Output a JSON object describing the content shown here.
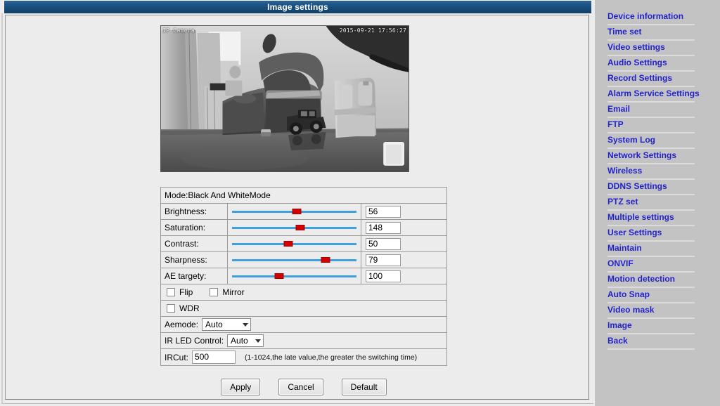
{
  "window": {
    "title": "Image settings"
  },
  "video": {
    "osd_label": "IP Camera",
    "osd_timestamp": "2015-09-21 17:56:27"
  },
  "settings": {
    "mode_text": "Mode:Black And WhiteMode",
    "sliders": [
      {
        "label": "Brightness:",
        "value": "56",
        "percent": 52
      },
      {
        "label": "Saturation:",
        "value": "148",
        "percent": 55
      },
      {
        "label": "Contrast:",
        "value": "50",
        "percent": 45
      },
      {
        "label": "Sharpness:",
        "value": "79",
        "percent": 75
      },
      {
        "label": "AE targety:",
        "value": "100",
        "percent": 38
      }
    ],
    "flip_label": "Flip",
    "mirror_label": "Mirror",
    "wdr_label": "WDR",
    "flip_checked": false,
    "mirror_checked": false,
    "wdr_checked": false,
    "aemode_label": "Aemode:",
    "aemode_value": "Auto",
    "aemode_options": [
      "Auto"
    ],
    "irled_label": "IR LED Control:",
    "irled_value": "Auto",
    "irled_options": [
      "Auto"
    ],
    "ircut_label": "IRCut:",
    "ircut_value": "500",
    "ircut_hint": "(1-1024,the late value,the greater the switching time)"
  },
  "buttons": {
    "apply": "Apply",
    "cancel": "Cancel",
    "default": "Default"
  },
  "sidebar": {
    "items": [
      {
        "label": "Device information"
      },
      {
        "label": "Time set"
      },
      {
        "label": "Video settings"
      },
      {
        "label": "Audio Settings"
      },
      {
        "label": "Record Settings"
      },
      {
        "label": "Alarm Service Settings"
      },
      {
        "label": "Email"
      },
      {
        "label": "FTP"
      },
      {
        "label": "System Log"
      },
      {
        "label": "Network Settings"
      },
      {
        "label": "Wireless"
      },
      {
        "label": "DDNS Settings"
      },
      {
        "label": "PTZ set"
      },
      {
        "label": "Multiple settings"
      },
      {
        "label": "User Settings"
      },
      {
        "label": "Maintain"
      },
      {
        "label": "ONVIF"
      },
      {
        "label": "Motion detection"
      },
      {
        "label": "Auto Snap"
      },
      {
        "label": "Video mask"
      },
      {
        "label": "Image"
      },
      {
        "label": "Back"
      }
    ]
  },
  "colors": {
    "titlebar": "#19507f",
    "link": "#2222cc",
    "sidebar_bg": "#c3c3c3",
    "slider_rail": "#3fa0e0",
    "slider_thumb": "#d40000"
  }
}
